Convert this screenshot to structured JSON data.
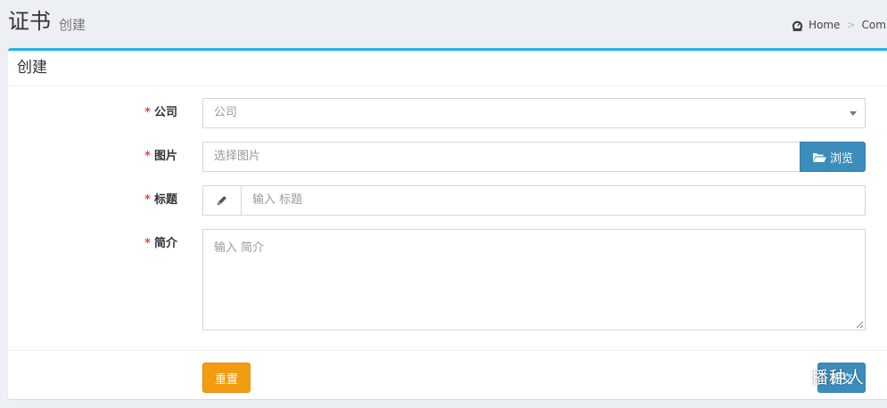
{
  "header": {
    "title": "证书",
    "subtitle": "创建",
    "breadcrumb": [
      "Home",
      "Compa"
    ]
  },
  "box": {
    "title": "创建"
  },
  "form": {
    "required_mark": "*",
    "company": {
      "label": "公司",
      "value": "公司"
    },
    "image": {
      "label": "图片",
      "placeholder": "选择图片",
      "browse_label": "浏览"
    },
    "title_field": {
      "label": "标题",
      "placeholder": "输入 标题"
    },
    "intro": {
      "label": "简介",
      "placeholder": "输入 简介"
    }
  },
  "footer": {
    "reset_label": "重置",
    "submit_label": "提交"
  },
  "watermark": "播种人",
  "colors": {
    "accent": "#1fb5e0",
    "primary": "#3c8dbc",
    "warning": "#f39c12",
    "required": "#dd4b39"
  },
  "icons": {
    "breadcrumb": "dashboard-icon",
    "browse": "folder-open-icon",
    "title_addon": "pencil-icon"
  }
}
